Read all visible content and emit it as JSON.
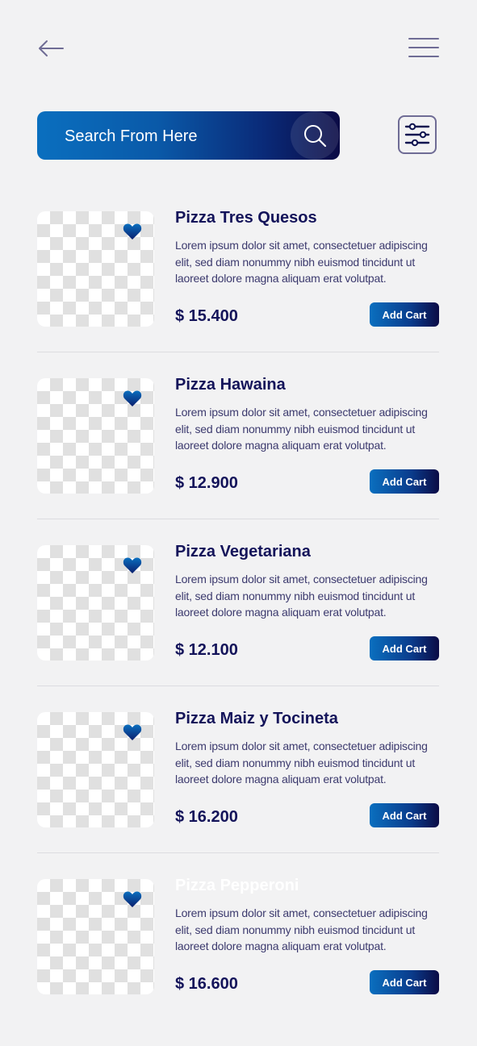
{
  "colors": {
    "background": "#f2f2f3",
    "brand_blue": "#0a6fbf",
    "brand_navy": "#0b0b45",
    "title_text": "#14145a",
    "icon_muted": "#6f6c95"
  },
  "header": {
    "back_icon": "arrow-left-icon",
    "menu_icon": "hamburger-menu-icon"
  },
  "search": {
    "placeholder": "Search From Here",
    "search_icon": "search-icon",
    "filter_icon": "sliders-filter-icon"
  },
  "products": [
    {
      "name": "Pizza Tres Quesos",
      "description": "Lorem ipsum dolor sit amet, consectetuer adipiscing elit, sed diam nonummy nibh euismod tincidunt ut laoreet dolore magna aliquam erat volutpat.",
      "price": "$ 15.400",
      "button": "Add Cart",
      "favorite_icon": "heart-icon"
    },
    {
      "name": "Pizza Hawaina",
      "description": "Lorem ipsum dolor sit amet, consectetuer adipiscing elit, sed diam nonummy nibh euismod tincidunt ut laoreet dolore magna aliquam erat volutpat.",
      "price": "$ 12.900",
      "button": "Add Cart",
      "favorite_icon": "heart-icon"
    },
    {
      "name": "Pizza Vegetariana",
      "description": "Lorem ipsum dolor sit amet, consectetuer adipiscing elit, sed diam nonummy nibh euismod tincidunt ut laoreet dolore magna aliquam erat volutpat.",
      "price": "$ 12.100",
      "button": "Add Cart",
      "favorite_icon": "heart-icon"
    },
    {
      "name": "Pizza Maiz y Tocineta",
      "description": "Lorem ipsum dolor sit amet, consectetuer adipiscing elit, sed diam nonummy nibh euismod tincidunt ut laoreet dolore magna aliquam erat volutpat.",
      "price": "$ 16.200",
      "button": "Add Cart",
      "favorite_icon": "heart-icon"
    },
    {
      "name": "Pizza Pepperoni",
      "description": "Lorem ipsum dolor sit amet, consectetuer adipiscing elit, sed diam nonummy nibh euismod tincidunt ut laoreet dolore magna aliquam erat volutpat.",
      "price": "$ 16.600",
      "button": "Add Cart",
      "favorite_icon": "heart-icon"
    }
  ]
}
